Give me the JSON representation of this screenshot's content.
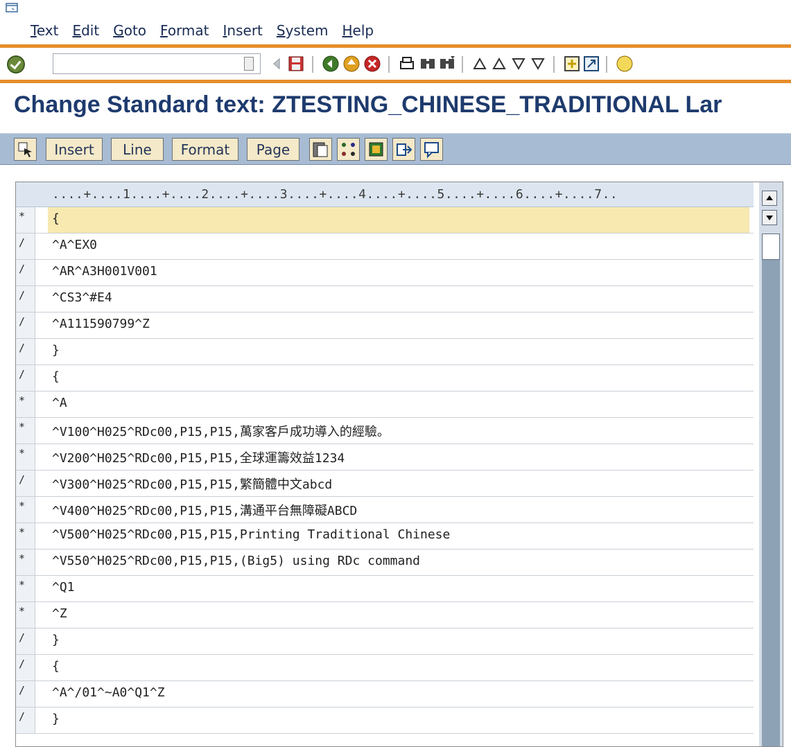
{
  "menu": {
    "items": [
      "Text",
      "Edit",
      "Goto",
      "Format",
      "Insert",
      "System",
      "Help"
    ]
  },
  "toolbar": {
    "command_value": ""
  },
  "title": {
    "text": "Change Standard text: ZTESTING_CHINESE_TRADITIONAL Lar"
  },
  "app_toolbar": {
    "insert": "Insert",
    "line": "Line",
    "format": "Format",
    "page": "Page"
  },
  "editor": {
    "ruler": "....+....1....+....2....+....3....+....4....+....5....+....6....+....7..",
    "rows": [
      {
        "fmt": "*",
        "text": "{"
      },
      {
        "fmt": "/",
        "text": "^A^EX0"
      },
      {
        "fmt": "/",
        "text": "^AR^A3H001V001"
      },
      {
        "fmt": "/",
        "text": "^CS3^#E4"
      },
      {
        "fmt": "/",
        "text": "^A111590799^Z"
      },
      {
        "fmt": "/",
        "text": "}"
      },
      {
        "fmt": "/",
        "text": "{"
      },
      {
        "fmt": "*",
        "text": "^A"
      },
      {
        "fmt": "*",
        "text": "^V100^H025^RDc00,P15,P15,萬家客戶成功導入的經驗。"
      },
      {
        "fmt": "*",
        "text": "^V200^H025^RDc00,P15,P15,全球運籌效益1234"
      },
      {
        "fmt": "/",
        "text": "^V300^H025^RDc00,P15,P15,繁簡體中文abcd"
      },
      {
        "fmt": "*",
        "text": "^V400^H025^RDc00,P15,P15,溝通平台無障礙ABCD"
      },
      {
        "fmt": "*",
        "text": "^V500^H025^RDc00,P15,P15,Printing Traditional Chinese"
      },
      {
        "fmt": "*",
        "text": "^V550^H025^RDc00,P15,P15,(Big5) using RDc command"
      },
      {
        "fmt": "*",
        "text": "^Q1"
      },
      {
        "fmt": "*",
        "text": "^Z"
      },
      {
        "fmt": "/",
        "text": "}"
      },
      {
        "fmt": "/",
        "text": "{"
      },
      {
        "fmt": "/",
        "text": "^A^/01^~A0^Q1^Z"
      },
      {
        "fmt": "/",
        "text": "}"
      }
    ]
  }
}
